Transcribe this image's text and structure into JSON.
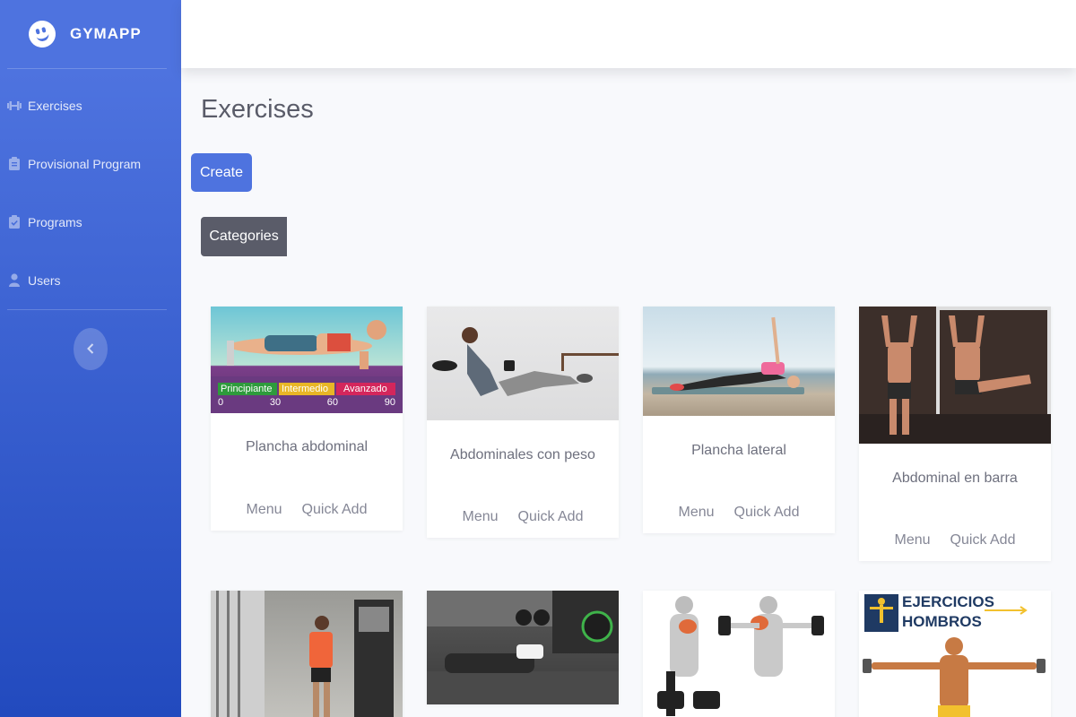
{
  "brand": {
    "name": "GYMAPP"
  },
  "sidebar": {
    "items": [
      {
        "label": "Exercises",
        "icon": "dumbbell-icon"
      },
      {
        "label": "Provisional Program",
        "icon": "clipboard-icon"
      },
      {
        "label": "Programs",
        "icon": "clipboard-check-icon"
      },
      {
        "label": "Users",
        "icon": "user-icon"
      }
    ],
    "toggle_icon": "chevron-left-icon"
  },
  "page": {
    "title": "Exercises",
    "create_label": "Create",
    "categories_label": "Categories"
  },
  "cards": [
    {
      "title": "Plancha abdominal",
      "menu": "Menu",
      "quick_add": "Quick Add",
      "image_labels": [
        "Principiante",
        "Intermedio",
        "Avanzado"
      ],
      "image_ticks": [
        "0",
        "30",
        "60",
        "90"
      ]
    },
    {
      "title": "Abdominales con peso",
      "menu": "Menu",
      "quick_add": "Quick Add"
    },
    {
      "title": "Plancha lateral",
      "menu": "Menu",
      "quick_add": "Quick Add"
    },
    {
      "title": "Abdominal en barra",
      "menu": "Menu",
      "quick_add": "Quick Add"
    },
    {
      "title": "",
      "menu": "",
      "quick_add": ""
    },
    {
      "title": "",
      "menu": "",
      "quick_add": ""
    },
    {
      "title": "",
      "menu": "",
      "quick_add": ""
    },
    {
      "title": "",
      "menu": "",
      "quick_add": "",
      "image_text": [
        "EJERCICIOS",
        "HOMBROS"
      ]
    }
  ],
  "colors": {
    "primary": "#4e73df",
    "dark": "#5a5c69",
    "background": "#f8f9fc"
  }
}
